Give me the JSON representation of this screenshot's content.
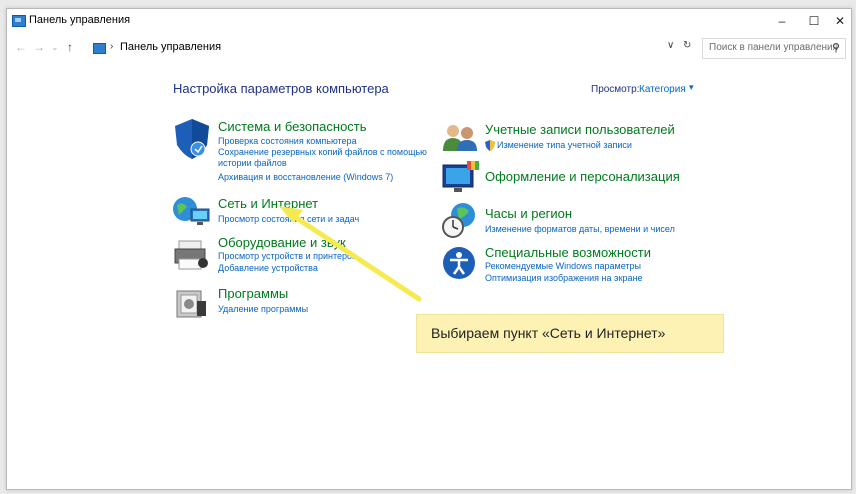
{
  "window": {
    "title": "Панель управления",
    "minimize_glyph": "–",
    "maximize_glyph": "☐",
    "close_glyph": "✕"
  },
  "address_bar": {
    "back_glyph": "←",
    "forward_glyph": "→",
    "recent_glyph": "⌄",
    "up_glyph": "↑",
    "separator": "›",
    "breadcrumb": "Панель управления",
    "dropdown_glyph": "∨",
    "refresh_glyph": "↻",
    "search_placeholder": "Поиск в панели управления",
    "search_glyph": "⚲"
  },
  "main": {
    "heading": "Настройка параметров компьютера",
    "view_label": "Просмотр:",
    "view_value": "Категория",
    "view_chevron": "▾"
  },
  "categories_left": [
    {
      "title": "Система и безопасность",
      "icon": "shield-icon",
      "links": [
        "Проверка состояния компьютера",
        "Сохранение резервных копий файлов с помощью",
        "истории файлов",
        "Архивация и восстановление (Windows 7)"
      ]
    },
    {
      "title": "Сеть и Интернет",
      "icon": "network-globe-icon",
      "links": [
        "Просмотр состояния сети и задач"
      ]
    },
    {
      "title": "Оборудование и звук",
      "icon": "printer-icon",
      "links": [
        "Просмотр устройств и принтеров",
        "Добавление устройства"
      ]
    },
    {
      "title": "Программы",
      "icon": "programs-icon",
      "links": [
        "Удаление программы"
      ]
    }
  ],
  "categories_right": [
    {
      "title": "Учетные записи пользователей",
      "icon": "users-icon",
      "links": [
        "Изменение типа учетной записи"
      ]
    },
    {
      "title": "Оформление и персонализация",
      "icon": "monitor-palette-icon",
      "links": []
    },
    {
      "title": "Часы и регион",
      "icon": "clock-globe-icon",
      "links": [
        "Изменение форматов даты, времени и чисел"
      ]
    },
    {
      "title": "Специальные возможности",
      "icon": "accessibility-icon",
      "links": [
        "Рекомендуемые Windows параметры",
        "Оптимизация изображения на экране"
      ]
    }
  ],
  "annotation": {
    "callout_text": "Выбираем пункт «Сеть и Интернет»",
    "color": "#f5ea4f"
  },
  "colors": {
    "category_title": "#007a1e",
    "link": "#0a64c8",
    "heading": "#1e3287"
  }
}
